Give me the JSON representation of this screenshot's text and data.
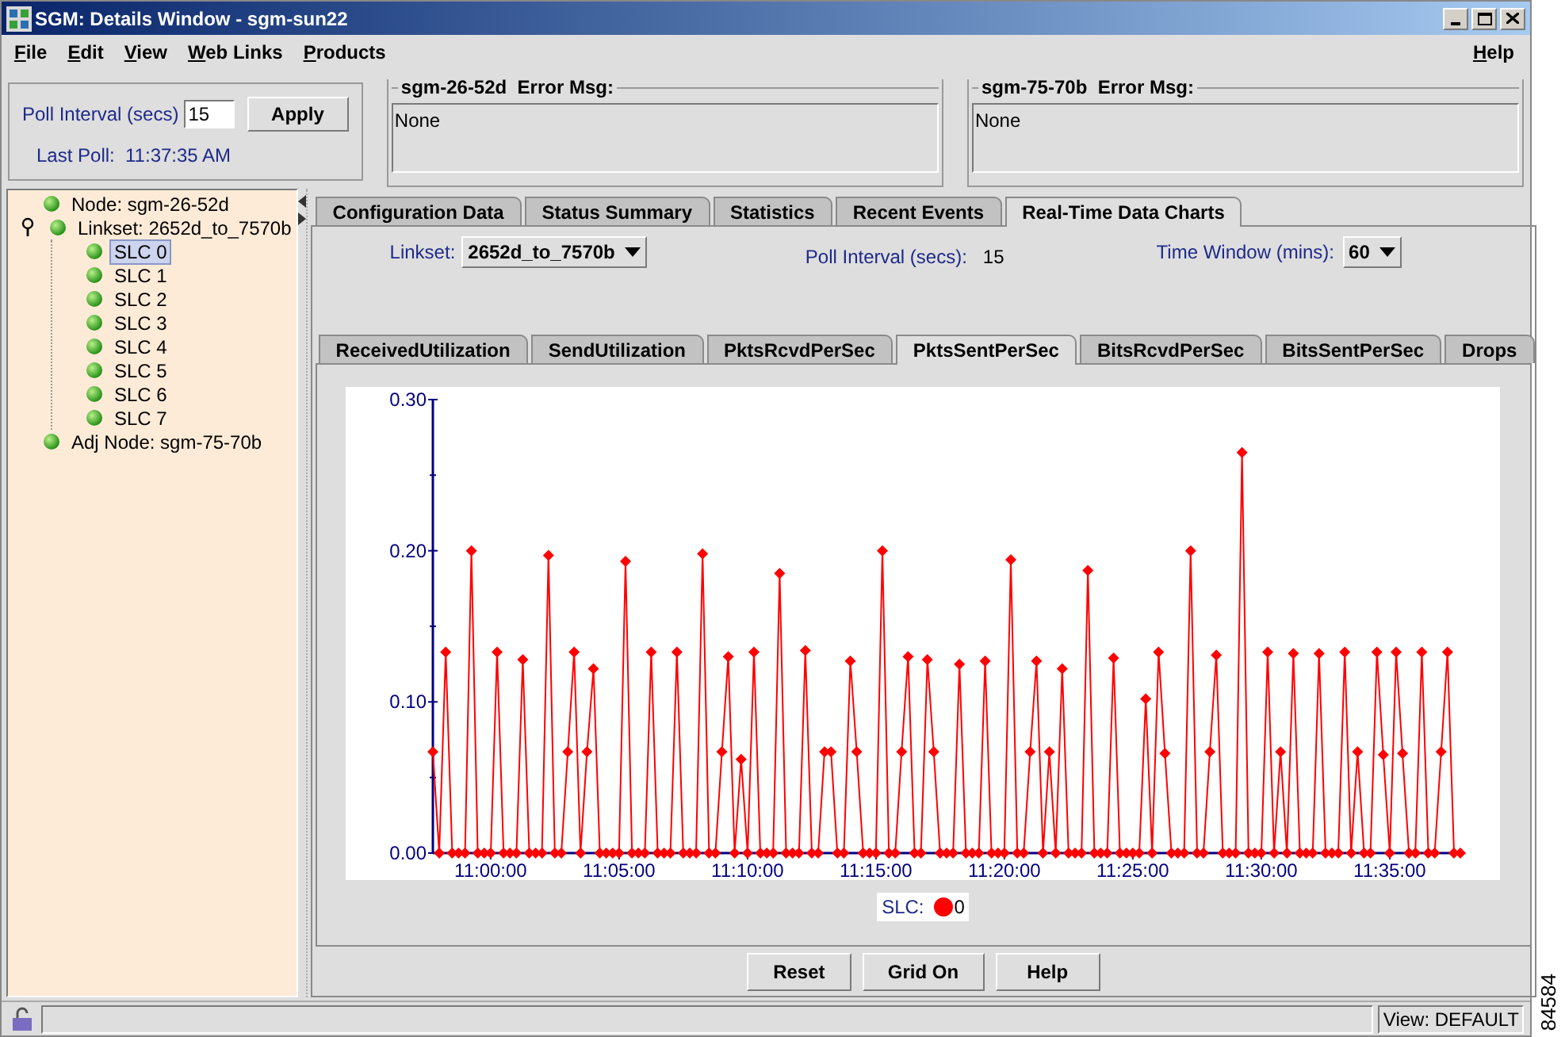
{
  "window": {
    "title": "SGM: Details Window - sgm-sun22"
  },
  "menu": [
    {
      "label": "File"
    },
    {
      "label": "Edit"
    },
    {
      "label": "View"
    },
    {
      "label": "Web Links"
    },
    {
      "label": "Products"
    }
  ],
  "help_menu": {
    "label": "Help"
  },
  "poll": {
    "label": "Poll Interval (secs)",
    "value": "15",
    "apply": "Apply",
    "last_poll": "Last Poll:  11:37:35 AM"
  },
  "error_panels": [
    {
      "title": "sgm-26-52d  Error Msg:",
      "message": "None"
    },
    {
      "title": "sgm-75-70b  Error Msg:",
      "message": "None"
    }
  ],
  "tree": [
    {
      "label": "Node: sgm-26-52d",
      "selected": false
    },
    {
      "label": "Linkset: 2652d_to_7570b",
      "selected": false,
      "expanded": true,
      "children": [
        {
          "label": "SLC 0",
          "selected": true
        },
        {
          "label": "SLC 1",
          "selected": false
        },
        {
          "label": "SLC 2",
          "selected": false
        },
        {
          "label": "SLC 3",
          "selected": false
        },
        {
          "label": "SLC 4",
          "selected": false
        },
        {
          "label": "SLC 5",
          "selected": false
        },
        {
          "label": "SLC 6",
          "selected": false
        },
        {
          "label": "SLC 7",
          "selected": false
        }
      ]
    },
    {
      "label": "Adj Node: sgm-75-70b",
      "selected": false
    }
  ],
  "tabs": [
    {
      "label": "Configuration Data",
      "selected": false
    },
    {
      "label": "Status Summary",
      "selected": false
    },
    {
      "label": "Statistics",
      "selected": false
    },
    {
      "label": "Recent Events",
      "selected": false
    },
    {
      "label": "Real-Time Data Charts",
      "selected": true
    }
  ],
  "controls": {
    "linkset_label": "Linkset:",
    "linkset_value": "2652d_to_7570b",
    "poll_label": "Poll Interval (secs):",
    "poll_value": "15",
    "window_label": "Time Window (mins):",
    "window_value": "60"
  },
  "chart_tabs": [
    {
      "label": "ReceivedUtilization",
      "selected": false
    },
    {
      "label": "SendUtilization",
      "selected": false
    },
    {
      "label": "PktsRcvdPerSec",
      "selected": false
    },
    {
      "label": "PktsSentPerSec",
      "selected": true
    },
    {
      "label": "BitsRcvdPerSec",
      "selected": false
    },
    {
      "label": "BitsSentPerSec",
      "selected": false
    },
    {
      "label": "Drops",
      "selected": false
    }
  ],
  "chart": {
    "legend_label": "SLC:",
    "chart_data": {
      "type": "line",
      "categories": [
        null,
        null,
        null,
        null,
        null,
        null,
        null,
        null,
        null,
        "11:00:00",
        null,
        null,
        null,
        null,
        null,
        null,
        null,
        null,
        null,
        null,
        null,
        null,
        null,
        null,
        null,
        null,
        null,
        null,
        null,
        "11:05:00",
        null,
        null,
        null,
        null,
        null,
        null,
        null,
        null,
        null,
        null,
        null,
        null,
        null,
        null,
        null,
        null,
        null,
        null,
        null,
        "11:10:00",
        null,
        null,
        null,
        null,
        null,
        null,
        null,
        null,
        null,
        null,
        null,
        null,
        null,
        null,
        null,
        null,
        null,
        null,
        null,
        "11:15:00",
        null,
        null,
        null,
        null,
        null,
        null,
        null,
        null,
        null,
        null,
        null,
        null,
        null,
        null,
        null,
        null,
        null,
        null,
        null,
        "11:20:00",
        null,
        null,
        null,
        null,
        null,
        null,
        null,
        null,
        null,
        null,
        null,
        null,
        null,
        null,
        null,
        null,
        null,
        null,
        null,
        "11:25:00",
        null,
        null,
        null,
        null,
        null,
        null,
        null,
        null,
        null,
        null,
        null,
        null,
        null,
        null,
        null,
        null,
        null,
        null,
        null,
        "11:30:00",
        null,
        null,
        null,
        null,
        null,
        null,
        null,
        null,
        null,
        null,
        null,
        null,
        null,
        null,
        null,
        null,
        null,
        null,
        null,
        "11:35:00",
        null,
        null,
        null,
        null,
        null,
        null,
        null,
        null,
        null,
        null,
        null
      ],
      "series": [
        {
          "name": "0",
          "color": "#ff0000",
          "marker": "diamond",
          "values": [
            0.067,
            0,
            0.133,
            0,
            0,
            0,
            0.2,
            0,
            0,
            0,
            0.133,
            0,
            0,
            0,
            0.128,
            0,
            0,
            0,
            0.197,
            0,
            0,
            0.067,
            0.133,
            0,
            0.067,
            0.122,
            0,
            0,
            0,
            0,
            0.193,
            0,
            0,
            0,
            0.133,
            0,
            0,
            0,
            0.133,
            0,
            0,
            0,
            0.198,
            0,
            0,
            0.067,
            0.13,
            0,
            0.062,
            0,
            0.133,
            0,
            0,
            0,
            0.185,
            0,
            0,
            0,
            0.134,
            0,
            0,
            0.067,
            0.067,
            0,
            0,
            0.127,
            0.067,
            0,
            0,
            0,
            0.2,
            0,
            0,
            0.067,
            0.13,
            0,
            0,
            0.128,
            0.067,
            0,
            0,
            0,
            0.125,
            0,
            0,
            0,
            0.127,
            0,
            0,
            0,
            0.194,
            0,
            0,
            0.067,
            0.127,
            0,
            0.067,
            0,
            0.122,
            0,
            0,
            0,
            0.187,
            0,
            0,
            0,
            0.129,
            0,
            0,
            0,
            0,
            0.102,
            0,
            0.133,
            0.066,
            0,
            0,
            0,
            0.2,
            0,
            0,
            0.067,
            0.131,
            0,
            0,
            0,
            0.265,
            0,
            0,
            0,
            0.133,
            0,
            0.067,
            0,
            0.132,
            0,
            0,
            0,
            0.132,
            0,
            0,
            0,
            0.133,
            0,
            0.067,
            0,
            0,
            0.133,
            0.065,
            0,
            0.133,
            0.066,
            0,
            0,
            0.133,
            0,
            0,
            0.067,
            0.133,
            0,
            0
          ]
        }
      ],
      "ylim": [
        0,
        0.3
      ],
      "yticks": [
        {
          "value": 0,
          "label": "0.00"
        },
        {
          "value": 0.1,
          "label": "0.10"
        },
        {
          "value": 0.2,
          "label": "0.20"
        },
        {
          "value": 0.3,
          "label": "0.30"
        }
      ]
    }
  },
  "buttons": [
    {
      "label": "Reset"
    },
    {
      "label": "Grid On"
    },
    {
      "label": "Help"
    }
  ],
  "status_bar": {
    "view": "View: DEFAULT"
  },
  "figure_number": "84584"
}
